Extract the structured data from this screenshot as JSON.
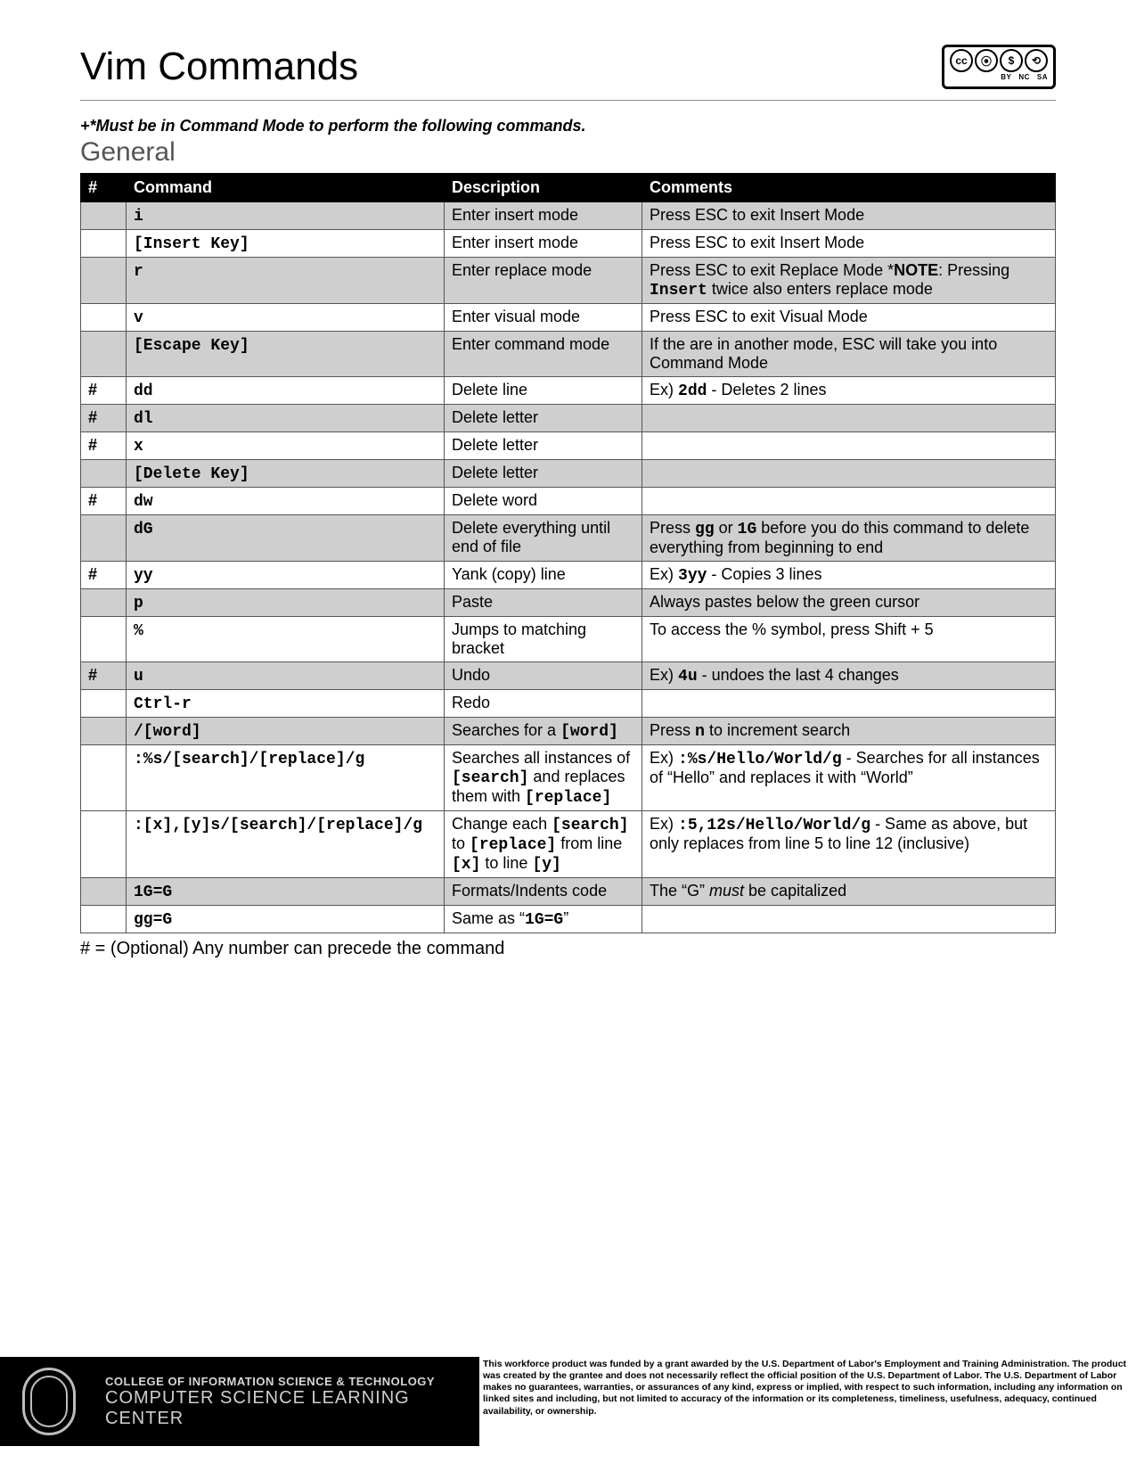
{
  "header": {
    "title": "Vim Commands",
    "license_labels": [
      "BY",
      "NC",
      "SA"
    ]
  },
  "note": "+*Must be in Command Mode to perform the following commands.",
  "section_title": "General",
  "columns": {
    "num": "#",
    "cmd": "Command",
    "desc": "Description",
    "comments": "Comments"
  },
  "rows": [
    {
      "shaded": true,
      "num": "",
      "cmd_mono": "i",
      "desc": [
        {
          "t": "Enter insert mode"
        }
      ],
      "comments": [
        {
          "t": "Press ESC to exit Insert Mode"
        }
      ]
    },
    {
      "shaded": false,
      "num": "",
      "cmd_mono": "[Insert Key]",
      "desc": [
        {
          "t": "Enter insert mode"
        }
      ],
      "comments": [
        {
          "t": "Press ESC to exit Insert Mode"
        }
      ]
    },
    {
      "shaded": true,
      "num": "",
      "cmd_mono": "r",
      "desc": [
        {
          "t": "Enter replace mode"
        }
      ],
      "comments": [
        {
          "t": "Press ESC to exit Replace Mode *"
        },
        {
          "t": "NOTE",
          "b": true
        },
        {
          "t": ": Pressing "
        },
        {
          "t": "Insert",
          "m": true
        },
        {
          "t": " twice also enters replace mode"
        }
      ]
    },
    {
      "shaded": false,
      "num": "",
      "cmd_mono": "v",
      "desc": [
        {
          "t": "Enter visual mode"
        }
      ],
      "comments": [
        {
          "t": "Press ESC to exit Visual Mode"
        }
      ]
    },
    {
      "shaded": true,
      "num": "",
      "cmd_mono": "[Escape Key]",
      "desc": [
        {
          "t": "Enter command mode"
        }
      ],
      "comments": [
        {
          "t": "If the are in another mode, ESC will take you into Command Mode"
        }
      ]
    },
    {
      "shaded": false,
      "num": "#",
      "cmd_mono": "dd",
      "desc": [
        {
          "t": "Delete line"
        }
      ],
      "comments": [
        {
          "t": "Ex) "
        },
        {
          "t": "2dd",
          "m": true
        },
        {
          "t": " - Deletes 2 lines"
        }
      ]
    },
    {
      "shaded": true,
      "num": "#",
      "cmd_mono": "dl",
      "desc": [
        {
          "t": "Delete letter"
        }
      ],
      "comments": []
    },
    {
      "shaded": false,
      "num": "#",
      "cmd_mono": "x",
      "desc": [
        {
          "t": "Delete letter"
        }
      ],
      "comments": []
    },
    {
      "shaded": true,
      "num": "",
      "cmd_mono": "[Delete Key]",
      "desc": [
        {
          "t": "Delete letter"
        }
      ],
      "comments": []
    },
    {
      "shaded": false,
      "num": "#",
      "cmd_mono": "dw",
      "desc": [
        {
          "t": "Delete word"
        }
      ],
      "comments": []
    },
    {
      "shaded": true,
      "num": "",
      "cmd_mono": "dG",
      "desc": [
        {
          "t": "Delete everything until end of file"
        }
      ],
      "comments": [
        {
          "t": "Press "
        },
        {
          "t": "gg",
          "m": true
        },
        {
          "t": " or "
        },
        {
          "t": "1G",
          "m": true
        },
        {
          "t": " before you do this command to delete everything from beginning to end"
        }
      ]
    },
    {
      "shaded": false,
      "num": "#",
      "cmd_mono": "yy",
      "desc": [
        {
          "t": "Yank (copy) line"
        }
      ],
      "comments": [
        {
          "t": "Ex) "
        },
        {
          "t": "3yy",
          "m": true
        },
        {
          "t": " - Copies 3 lines"
        }
      ]
    },
    {
      "shaded": true,
      "num": "",
      "cmd_mono": "p",
      "desc": [
        {
          "t": "Paste"
        }
      ],
      "comments": [
        {
          "t": "Always pastes below the green cursor"
        }
      ]
    },
    {
      "shaded": false,
      "num": "",
      "cmd_mono": "%",
      "desc": [
        {
          "t": "Jumps to matching bracket"
        }
      ],
      "comments": [
        {
          "t": "To access the % symbol, press Shift + 5"
        }
      ]
    },
    {
      "shaded": true,
      "num": "#",
      "cmd_mono": "u",
      "desc": [
        {
          "t": "Undo"
        }
      ],
      "comments": [
        {
          "t": "Ex) "
        },
        {
          "t": "4u",
          "m": true
        },
        {
          "t": " - undoes the last 4 changes"
        }
      ]
    },
    {
      "shaded": false,
      "num": "",
      "cmd_mono": "Ctrl-r",
      "desc": [
        {
          "t": "Redo"
        }
      ],
      "comments": []
    },
    {
      "shaded": true,
      "num": "",
      "cmd_mono": "/[word]",
      "desc": [
        {
          "t": "Searches for a "
        },
        {
          "t": "[word]",
          "m": true
        }
      ],
      "comments": [
        {
          "t": "Press "
        },
        {
          "t": "n",
          "b": true
        },
        {
          "t": " to increment search"
        }
      ]
    },
    {
      "shaded": false,
      "num": "",
      "cmd_mono": ":%s/[search]/[replace]/g",
      "desc": [
        {
          "t": "Searches all instances of "
        },
        {
          "t": "[search]",
          "m": true
        },
        {
          "t": " and replaces them with "
        },
        {
          "t": "[replace]",
          "m": true
        }
      ],
      "comments": [
        {
          "t": "Ex) "
        },
        {
          "t": ":%s/Hello/World/g",
          "m": true
        },
        {
          "t": " - Searches for all instances of “Hello” and replaces it with “World”"
        }
      ]
    },
    {
      "shaded": false,
      "num": "",
      "cmd_mono": ":[x],[y]s/[search]/[replace]/g",
      "desc": [
        {
          "t": "Change each "
        },
        {
          "t": "[search]",
          "m": true
        },
        {
          "t": " to "
        },
        {
          "t": "[replace]",
          "m": true
        },
        {
          "t": " from line "
        },
        {
          "t": "[x]",
          "m": true
        },
        {
          "t": " to line "
        },
        {
          "t": "[y]",
          "m": true
        }
      ],
      "comments": [
        {
          "t": "Ex) "
        },
        {
          "t": ":5,12s/Hello/World/g",
          "m": true
        },
        {
          "t": " - Same as above, but only replaces from line 5 to line 12 (inclusive)"
        }
      ]
    },
    {
      "shaded": true,
      "num": "",
      "cmd_mono": "1G=G",
      "desc": [
        {
          "t": "Formats/Indents code"
        }
      ],
      "comments": [
        {
          "t": "The “G” "
        },
        {
          "t": "must",
          "i": true
        },
        {
          "t": " be capitalized"
        }
      ]
    },
    {
      "shaded": false,
      "num": "",
      "cmd_mono": "gg=G",
      "desc": [
        {
          "t": "Same as “"
        },
        {
          "t": "1G=G",
          "m": true
        },
        {
          "t": "”"
        }
      ],
      "comments": []
    }
  ],
  "legend": "# = (Optional) Any number can precede the command",
  "footer": {
    "org_line1": "COLLEGE OF INFORMATION SCIENCE & TECHNOLOGY",
    "org_line2": "COMPUTER SCIENCE LEARNING CENTER",
    "disclaimer": "This workforce product was funded by a grant awarded by the U.S. Department of Labor's Employment and Training Administration. The product was created by the grantee and does not necessarily reflect the official position of the U.S. Department of Labor. The U.S. Department of Labor makes no guarantees, warranties, or assurances of any kind, express or implied, with respect to such information, including any information on linked sites and including, but not limited to accuracy of the information or its completeness, timeliness, usefulness, adequacy, continued availability, or ownership."
  }
}
